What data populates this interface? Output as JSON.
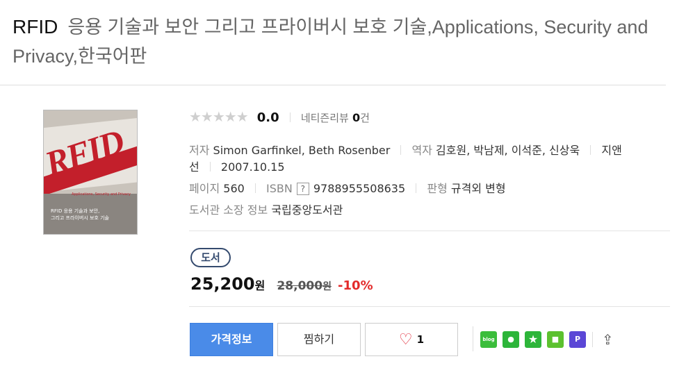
{
  "title": {
    "main": "RFID",
    "rest": "응용 기술과 보안 그리고 프라이버시 보호 기술,Applications, Security and Privacy,한국어판"
  },
  "rating": {
    "stars": "★★★★★",
    "score": "0.0",
    "review_label": "네티즌리뷰",
    "review_count": "0",
    "review_unit": "건"
  },
  "meta": {
    "author_label": "저자",
    "author": "Simon Garfinkel, Beth Rosenber",
    "translator_label": "역자",
    "translator": "김호원, 박남제, 이석준, 신상욱",
    "publisher_part1": "지앤",
    "publisher_part2": "선",
    "date": "2007.10.15",
    "pages_label": "페이지",
    "pages": "560",
    "isbn_label": "ISBN",
    "isbn_help": "?",
    "isbn": "9788955508635",
    "format_label": "판형",
    "format": "규격외 변형",
    "library_label": "도서관 소장 정보",
    "library": "국립중앙도서관"
  },
  "cover": {
    "logo_text": "RFID",
    "subtitle": "Applications, Security and Privacy",
    "caption_line1": "RFID 응용 기술과 보안,",
    "caption_line2": "그리고 프라이버시 보호 기술"
  },
  "badge": "도서",
  "price": {
    "sale": "25,200",
    "sale_unit": "원",
    "original": "28,000",
    "original_unit": "원",
    "discount": "-10%"
  },
  "buttons": {
    "price_info": "가격정보",
    "wishlist": "찜하기",
    "like_count": "1"
  },
  "share": {
    "blog": "blog",
    "cafe": "●",
    "star": "★",
    "note": "■",
    "p": "P"
  }
}
